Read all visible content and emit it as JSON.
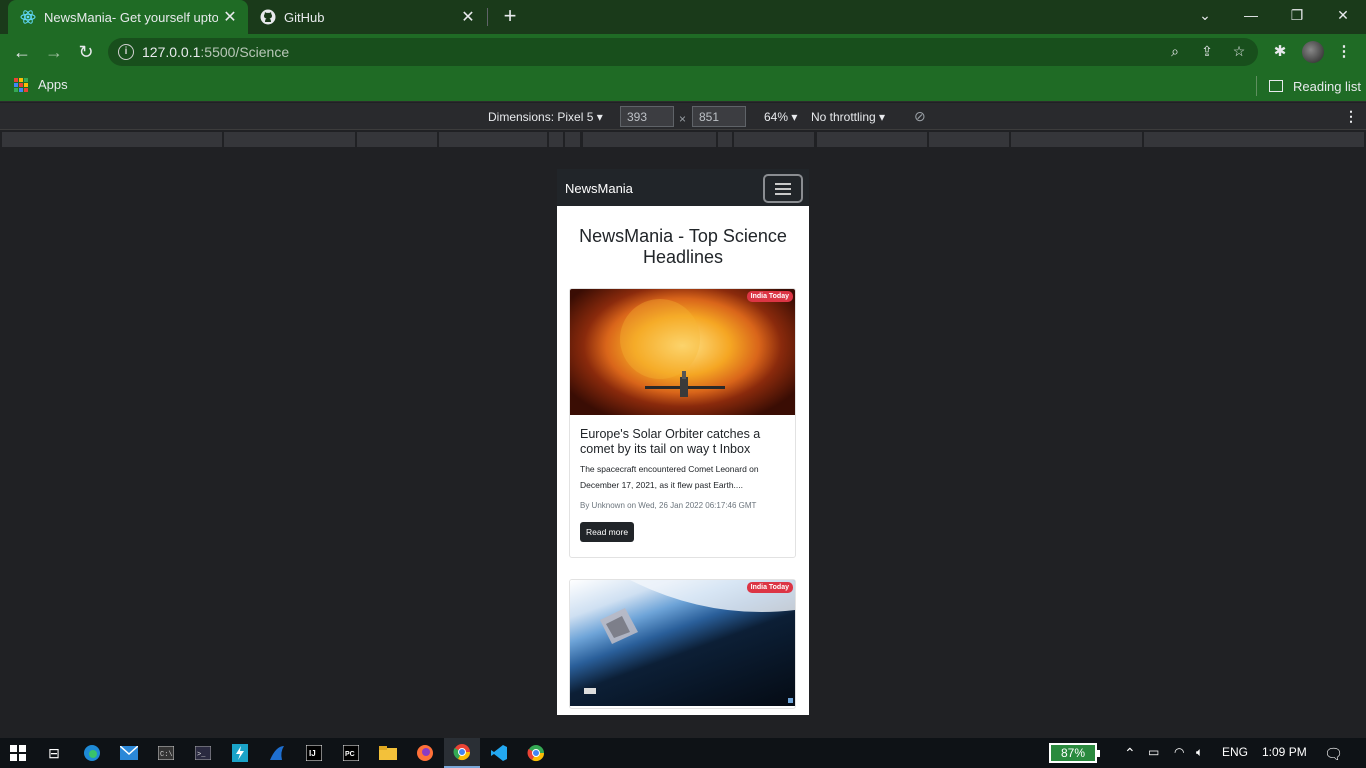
{
  "browser": {
    "tabs": [
      {
        "title": "NewsMania- Get yourself uptoda",
        "active": true
      },
      {
        "title": "GitHub",
        "active": false
      }
    ],
    "url_host": "127.0.0.1",
    "url_path": ":5500/Science",
    "bookmarks": {
      "apps_label": "Apps",
      "reading_list_label": "Reading list"
    }
  },
  "devtools": {
    "dimensions_label": "Dimensions: Pixel 5",
    "width": "393",
    "height": "851",
    "times": "×",
    "zoom": "64%",
    "throttling": "No throttling"
  },
  "page": {
    "brand": "NewsMania",
    "heading": "NewsMania - Top Science Headlines",
    "cards": [
      {
        "source": "India Today",
        "title": "Europe's Solar Orbiter catches a comet by its tail on way t Inbox",
        "description": "The spacecraft encountered Comet Leonard on December 17, 2021, as it flew past Earth....",
        "meta": "By Unknown on Wed, 26 Jan 2022 06:17:46 GMT",
        "button": "Read more"
      },
      {
        "source": "India Today"
      }
    ]
  },
  "taskbar": {
    "battery": "87%",
    "language": "ENG",
    "time": "1:09 PM"
  },
  "colors": {
    "chrome_frame": "#1f6b25",
    "navbar_dark": "#212529",
    "badge_red": "#dc3545"
  }
}
